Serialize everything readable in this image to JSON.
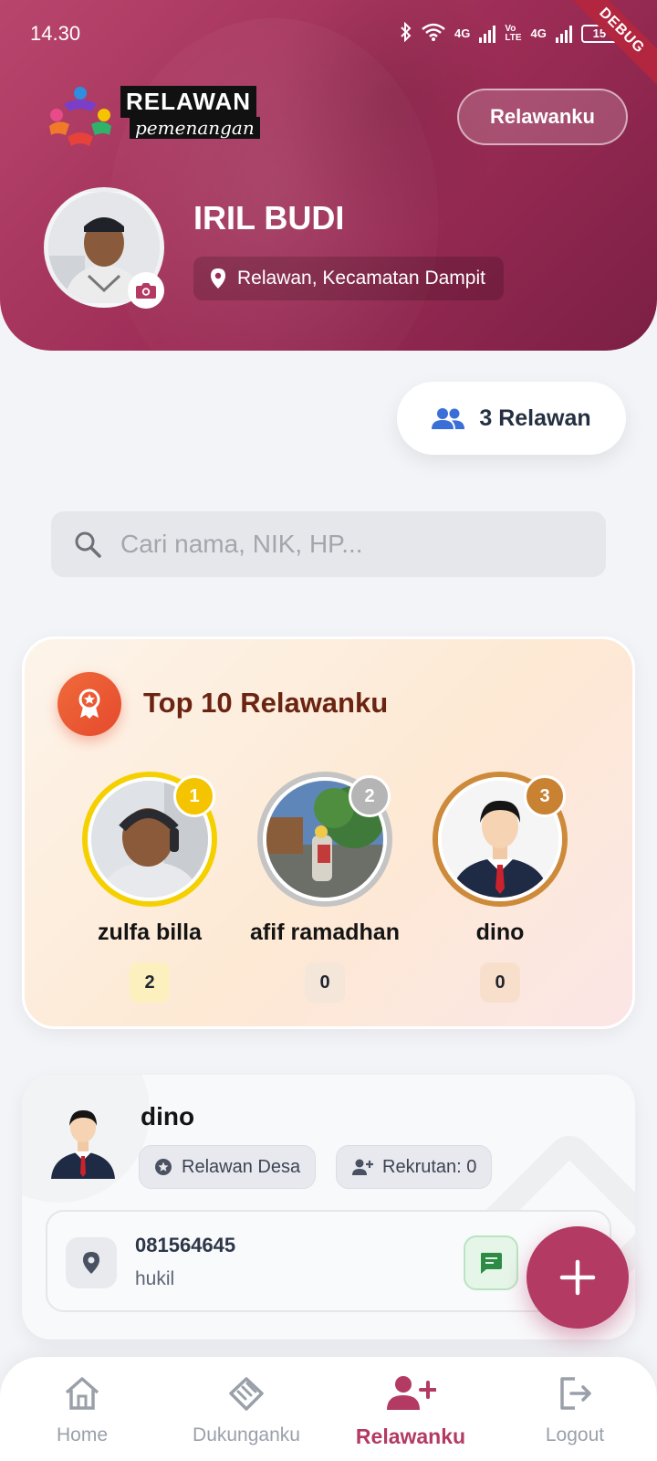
{
  "status_bar": {
    "time": "14.30",
    "net1": "4G",
    "net2": "Vo\nLTE",
    "net3": "4G",
    "battery": "15",
    "debug": "DEBUG"
  },
  "header": {
    "logo_text_1": "RELAWAN",
    "logo_text_2": "pemenangan",
    "action_button": "Relawanku",
    "profile_name": "IRIL BUDI",
    "profile_role": "Relawan, Kecamatan Dampit"
  },
  "count_pill": {
    "label": "3 Relawan"
  },
  "search": {
    "placeholder": "Cari nama, NIK, HP..."
  },
  "top_card": {
    "title": "Top 10 Relawanku",
    "podium": [
      {
        "rank": "1",
        "name": "zulfa billa",
        "count": "2",
        "ring": "#f5d000",
        "badge": "#f5c400",
        "count_bg": "#fdf0bf"
      },
      {
        "rank": "2",
        "name": "afif ramadhan",
        "count": "0",
        "ring": "#c4c4c4",
        "badge": "#b5b5b5",
        "count_bg": "#f4e7da"
      },
      {
        "rank": "3",
        "name": "dino",
        "count": "0",
        "ring": "#cd8a3a",
        "badge": "#c98132",
        "count_bg": "#f8dfcc"
      }
    ]
  },
  "member": {
    "name": "dino",
    "chip_role": "Relawan Desa",
    "chip_recruits": "Rekrutan: 0",
    "phone": "081564645",
    "address": "hukil"
  },
  "bottom_nav": {
    "items": [
      {
        "label": "Home"
      },
      {
        "label": "Dukunganku"
      },
      {
        "label": "Relawanku"
      },
      {
        "label": "Logout"
      }
    ]
  },
  "colors": {
    "brand": "#b33a63",
    "header_gradient_start": "#b8456c",
    "header_gradient_end": "#7c1f45",
    "award": "#e54a2d",
    "title_brown": "#6b2412",
    "count_icon_blue": "#3b6fd8"
  }
}
